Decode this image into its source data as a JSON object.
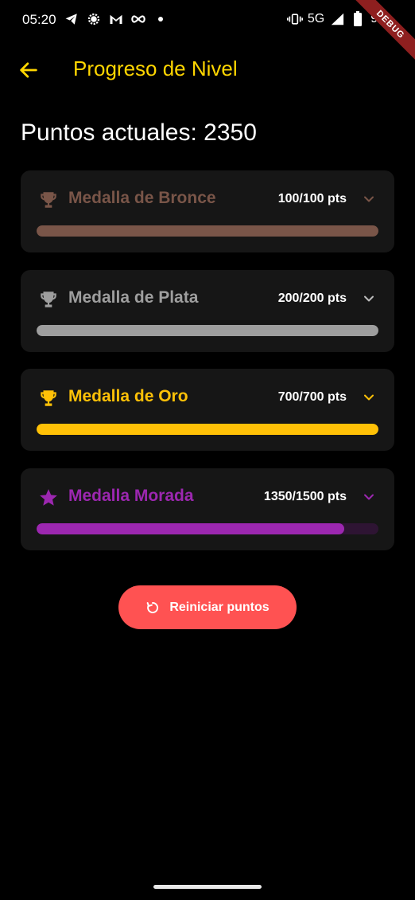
{
  "status_bar": {
    "time": "05:20",
    "network": "5G",
    "battery": "99",
    "debug_banner": "DEBUG"
  },
  "app_bar": {
    "title": "Progreso de Nivel",
    "title_color": "#ffd600"
  },
  "points_label": "Puntos actuales: 2350",
  "medals": [
    {
      "name": "Medalla de Bronce",
      "progress_text": "100/100 pts",
      "current": 100,
      "target": 100,
      "icon": "trophy-icon",
      "color": "#795548",
      "track_color": "#3a2a24"
    },
    {
      "name": "Medalla de Plata",
      "progress_text": "200/200 pts",
      "current": 200,
      "target": 200,
      "icon": "trophy-icon",
      "color": "#9e9e9e",
      "track_color": "#3a3a3a"
    },
    {
      "name": "Medalla de Oro",
      "progress_text": "700/700 pts",
      "current": 700,
      "target": 700,
      "icon": "trophy-icon",
      "color": "#ffc107",
      "track_color": "#4a3a00"
    },
    {
      "name": "Medalla Morada",
      "progress_text": "1350/1500 pts",
      "current": 1350,
      "target": 1500,
      "icon": "star-icon",
      "color": "#9c27b0",
      "track_color": "#2e1433"
    }
  ],
  "reset_button": {
    "label": "Reiniciar puntos",
    "color": "#ff5252",
    "icon": "refresh-icon"
  }
}
